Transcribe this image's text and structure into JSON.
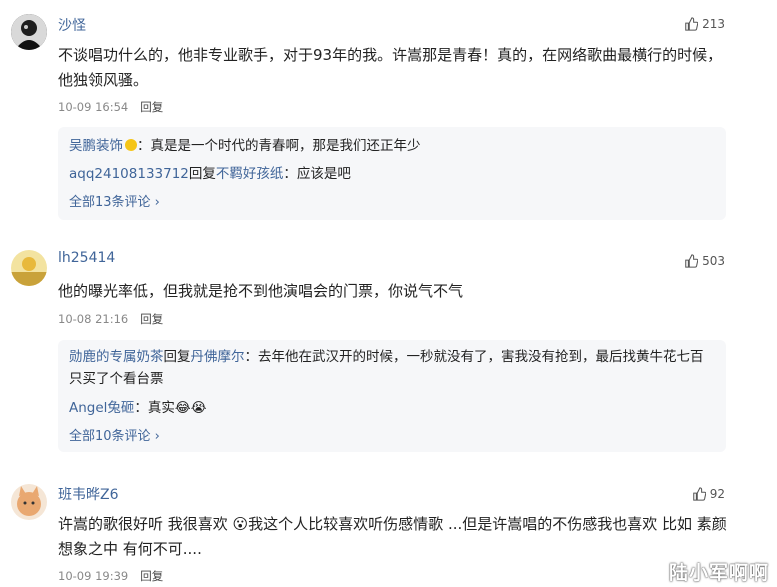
{
  "comments": [
    {
      "username": "沙怪",
      "likes": "213",
      "text": "不谈唱功什么的，他非专业歌手，对于93年的我。许嵩那是青春！真的，在网络歌曲最横行的时候，他独领风骚。",
      "time": "10-09 16:54",
      "reply_label": "回复",
      "subreplies": [
        {
          "user": "吴鹏装饰",
          "badge": true,
          "content": "：真是是一个时代的青春啊，那是我们还正年少"
        },
        {
          "user": "aqq24108133712",
          "reply_word": "回复",
          "target": "不羁好孩纸",
          "content": "：应该是吧"
        }
      ],
      "more": "全部13条评论"
    },
    {
      "username": "lh25414",
      "likes": "503",
      "text": "他的曝光率低，但我就是抢不到他演唱会的门票，你说气不气",
      "time": "10-08 21:16",
      "reply_label": "回复",
      "subreplies": [
        {
          "user": "勋鹿的专属奶茶",
          "reply_word": "回复",
          "target": "丹佛摩尔",
          "content": "：去年他在武汉开的时候，一秒就没有了，害我没有抢到，最后找黄牛花七百只买了个看台票"
        },
        {
          "user": "Angel兔砸",
          "content": "：真实",
          "emojis": "😂😭"
        }
      ],
      "more": "全部10条评论"
    },
    {
      "username": "班韦晔Z6",
      "likes": "92",
      "text": "许嵩的歌很好听 我很喜欢 😮我这个人比较喜欢听伤感情歌 ...但是许嵩唱的不伤感我也喜欢 比如 素颜 想象之中 有何不可....",
      "time": "10-09 19:39",
      "reply_label": "回复"
    }
  ],
  "watermark": "陆小军啊啊",
  "colors": {
    "link": "#406599",
    "subbox_bg": "#f6f7f9"
  }
}
